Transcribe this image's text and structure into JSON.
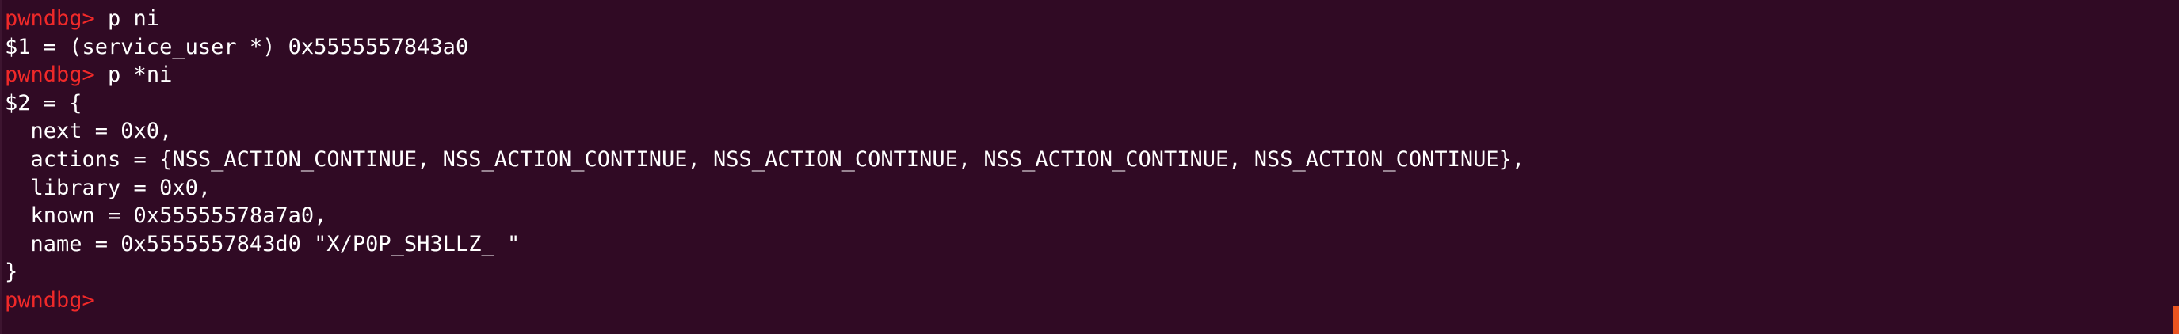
{
  "terminal": {
    "prompt": "pwndbg> ",
    "lines": [
      {
        "type": "prompt",
        "text": "p ni"
      },
      {
        "type": "output",
        "text": "$1 = (service_user *) 0x5555557843a0"
      },
      {
        "type": "prompt",
        "text": "p *ni"
      },
      {
        "type": "output",
        "text": "$2 = {"
      },
      {
        "type": "output",
        "text": "  next = 0x0,"
      },
      {
        "type": "output",
        "text": "  actions = {NSS_ACTION_CONTINUE, NSS_ACTION_CONTINUE, NSS_ACTION_CONTINUE, NSS_ACTION_CONTINUE, NSS_ACTION_CONTINUE},"
      },
      {
        "type": "output",
        "text": "  library = 0x0,"
      },
      {
        "type": "output",
        "text": "  known = 0x55555578a7a0,"
      },
      {
        "type": "output",
        "text": "  name = 0x5555557843d0 \"X/P0P_SH3LLZ_ \""
      },
      {
        "type": "output",
        "text": "}"
      },
      {
        "type": "prompt",
        "text": ""
      }
    ]
  },
  "colors": {
    "background": "#300a24",
    "prompt": "#ef2929",
    "text": "#ffffff",
    "scroll_thumb": "#e95420"
  }
}
